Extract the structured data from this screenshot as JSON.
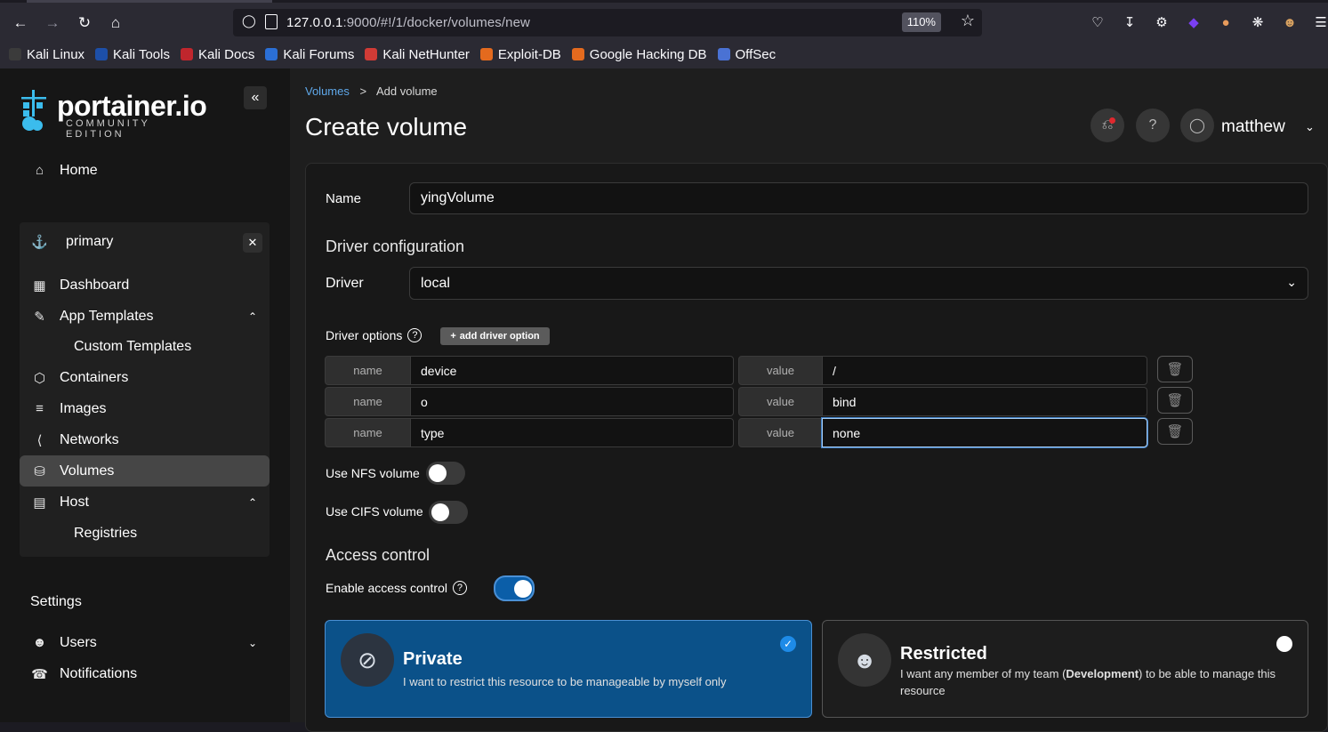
{
  "browser": {
    "url_host": "127.0.0.1",
    "url_rest": ":9000/#!/1/docker/volumes/new",
    "zoom": "110%",
    "bookmarks": [
      {
        "label": "Kali Linux",
        "color": "#3b3b3b"
      },
      {
        "label": "Kali Tools",
        "color": "#1d4fa8"
      },
      {
        "label": "Kali Docs",
        "color": "#c0262d"
      },
      {
        "label": "Kali Forums",
        "color": "#2b6fd6"
      },
      {
        "label": "Kali NetHunter",
        "color": "#d13b36"
      },
      {
        "label": "Exploit-DB",
        "color": "#e46a1e"
      },
      {
        "label": "Google Hacking DB",
        "color": "#e46a1e"
      },
      {
        "label": "OffSec",
        "color": "#4a72d4"
      }
    ]
  },
  "sidebar": {
    "logo_main": "portainer.io",
    "logo_sub": "COMMUNITY EDITION",
    "home": "Home",
    "env_name": "primary",
    "items": [
      "Dashboard",
      "App Templates",
      "Custom Templates",
      "Containers",
      "Images",
      "Networks",
      "Volumes",
      "Host",
      "Registries"
    ],
    "settings": "Settings",
    "users": "Users",
    "notifications": "Notifications"
  },
  "header": {
    "breadcrumb_link": "Volumes",
    "breadcrumb_sep": ">",
    "breadcrumb_current": "Add volume",
    "title": "Create volume",
    "username": "matthew"
  },
  "form": {
    "name_label": "Name",
    "name_value": "yingVolume",
    "driver_section": "Driver configuration",
    "driver_label": "Driver",
    "driver_value": "local",
    "driver_options_label": "Driver options",
    "add_option_label": "add driver option",
    "option_name_addon": "name",
    "option_value_addon": "value",
    "options": [
      {
        "name": "device",
        "value": "/"
      },
      {
        "name": "o",
        "value": "bind"
      },
      {
        "name": "type",
        "value": "none"
      }
    ],
    "nfs_label": "Use NFS volume",
    "cifs_label": "Use CIFS volume",
    "access_section": "Access control",
    "access_label": "Enable access control",
    "private_title": "Private",
    "private_desc": "I want to restrict this resource to be manageable by myself only",
    "restricted_title": "Restricted",
    "restricted_desc_pre": "I want any member of my team (",
    "restricted_team": "Development",
    "restricted_desc_post": ") to be able to manage this resource"
  }
}
